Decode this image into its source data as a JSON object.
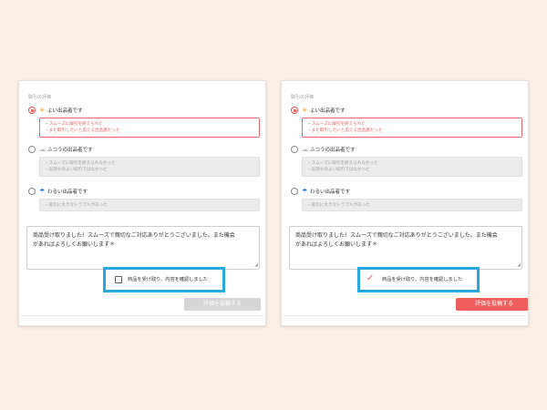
{
  "panels": [
    {
      "id": "before",
      "section_title": "取引の評価",
      "options": [
        {
          "label": "よい出品者です",
          "icon": "sun-icon",
          "selected": true,
          "lines": [
            "・スムーズに取引を終えられた",
            "・また取引したいと思える出品者だった"
          ]
        },
        {
          "label": "ふつうの出品者です",
          "icon": "cloud-icon",
          "selected": false,
          "lines": [
            "・スムーズに取引を終えられなかった",
            "・気持ちのよい取引ではなかった"
          ]
        },
        {
          "label": "わるい出品者です",
          "icon": "umbrella-icon",
          "selected": false,
          "lines": [
            "・取引に大きなトラブルがあった"
          ]
        }
      ],
      "comment_lines": [
        "商品受け取りました！スムーズで親切なご対応ありがとうございました。また機会",
        "があればよろしくお願いします＊"
      ],
      "checkbox_label": "商品を受け取り、内容を確認しました",
      "checkbox_checked": false,
      "submit_label": "評価を投稿する",
      "submit_enabled": false
    },
    {
      "id": "after",
      "section_title": "取引の評価",
      "options": [
        {
          "label": "よい出品者です",
          "icon": "sun-icon",
          "selected": true,
          "lines": [
            "・スムーズに取引を終えられた",
            "・また取引したいと思える出品者だった"
          ]
        },
        {
          "label": "ふつうの出品者です",
          "icon": "cloud-icon",
          "selected": false,
          "lines": [
            "・スムーズに取引を終えられなかった",
            "・気持ちのよい取引ではなかった"
          ]
        },
        {
          "label": "わるい出品者です",
          "icon": "umbrella-icon",
          "selected": false,
          "lines": [
            "・取引に大きなトラブルがあった"
          ]
        }
      ],
      "comment_lines": [
        "商品受け取りました！スムーズで親切なご対応ありがとうございました。また機会",
        "があればよろしくお願いします＊"
      ],
      "checkbox_label": "商品を受け取り、内容を確認しました",
      "checkbox_checked": true,
      "submit_label": "評価を投稿する",
      "submit_enabled": true
    }
  ],
  "colors": {
    "background": "#fcefe6",
    "accent_red": "#ef5d5d",
    "highlight_blue": "#29a8df",
    "disabled_gray": "#d6d6d6"
  }
}
